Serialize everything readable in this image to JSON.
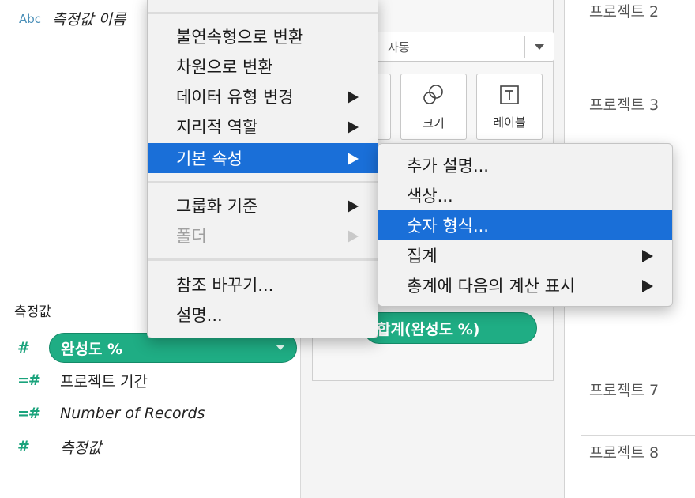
{
  "data_pane": {
    "dimension_icon": "Abc",
    "dimension_label": "측정값 이름",
    "measures_header": "측정값",
    "measures": [
      {
        "icon": "#",
        "label": "완성도 %",
        "selected": true
      },
      {
        "icon": "=#",
        "label": "프로젝트 기간"
      },
      {
        "icon": "=#",
        "label": "Number of Records",
        "italic": true
      },
      {
        "icon": "#",
        "label": "측정값",
        "italic": true
      }
    ]
  },
  "marks": {
    "mark_type_value": "자동",
    "size_label": "크기",
    "label_label": "레이블",
    "pill_label": "합계(완성도 %)"
  },
  "view": {
    "rows": [
      "프로젝트 2",
      "프로젝트 3",
      "프로젝트 7",
      "프로젝트 8"
    ]
  },
  "context_menu": {
    "items": [
      "불연속형으로 변환",
      "차원으로 변환",
      "데이터 유형 변경",
      "지리적 역할",
      "기본 속성",
      "그룹화 기준",
      "폴더",
      "참조 바꾸기...",
      "설명..."
    ],
    "active_item": "기본 속성",
    "disabled_item": "폴더"
  },
  "submenu": {
    "items": [
      "추가 설명...",
      "색상...",
      "숫자 형식...",
      "집계",
      "총계에 다음의 계산 표시"
    ],
    "active_item": "숫자 형식..."
  },
  "colors": {
    "accent": "#1a6fd8",
    "pill_green": "#1fad84",
    "measure_icon_green": "#1aa37c",
    "dimension_icon_blue": "#4a8fb8"
  }
}
